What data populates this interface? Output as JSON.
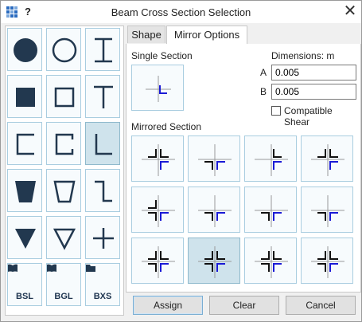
{
  "window": {
    "title": "Beam Cross Section Selection",
    "help_label": "?",
    "close_glyph": "✕",
    "app_icon": "grid-icon",
    "accent_color": "#2a6bbf",
    "selected_tile_color": "#cfe3ec"
  },
  "shapes": [
    {
      "name": "solid-circle",
      "icon": "solid-circle-icon"
    },
    {
      "name": "hollow-circle",
      "icon": "hollow-circle-icon"
    },
    {
      "name": "i-beam",
      "icon": "i-beam-icon"
    },
    {
      "name": "solid-square",
      "icon": "solid-square-icon"
    },
    {
      "name": "hollow-square",
      "icon": "hollow-square-icon"
    },
    {
      "name": "t-section",
      "icon": "t-section-icon"
    },
    {
      "name": "channel",
      "icon": "channel-icon"
    },
    {
      "name": "lipped-channel",
      "icon": "lipped-channel-icon"
    },
    {
      "name": "angle",
      "icon": "angle-icon",
      "selected": true
    },
    {
      "name": "solid-trapezoid",
      "icon": "solid-trapezoid-icon"
    },
    {
      "name": "hollow-trapezoid",
      "icon": "hollow-trapezoid-icon"
    },
    {
      "name": "z-section",
      "icon": "z-section-icon"
    },
    {
      "name": "solid-triangle",
      "icon": "solid-triangle-icon"
    },
    {
      "name": "hollow-triangle",
      "icon": "hollow-triangle-icon"
    },
    {
      "name": "cross",
      "icon": "cross-icon"
    }
  ],
  "libraries": [
    {
      "label": "BSL",
      "icon": "book-icon"
    },
    {
      "label": "BGL",
      "icon": "book-icon"
    },
    {
      "label": "BXS",
      "icon": "folder-icon"
    }
  ],
  "tabs": [
    {
      "label": "Shape",
      "active": false
    },
    {
      "label": "Mirror Options",
      "active": true
    }
  ],
  "mirror": {
    "single_section_label": "Single Section",
    "dimensions_label": "Dimensions: m",
    "dim_a_label": "A",
    "dim_a_value": "0.005",
    "dim_b_label": "B",
    "dim_b_value": "0.005",
    "compatible_shear_label": "Compatible Shear",
    "compatible_shear_checked": false,
    "mirrored_section_label": "Mirrored Section",
    "arrangements": [
      {
        "name": "mirror-ab-1"
      },
      {
        "name": "mirror-b-1"
      },
      {
        "name": "mirror-a-1"
      },
      {
        "name": "mirror-a-2"
      },
      {
        "name": "mirror-ab-2"
      },
      {
        "name": "mirror-ab-3"
      },
      {
        "name": "mirror-ab-4"
      },
      {
        "name": "mirror-ab-5"
      },
      {
        "name": "mirror-ab-6"
      },
      {
        "name": "mirror-quad-1",
        "selected": true
      },
      {
        "name": "mirror-ab-7"
      },
      {
        "name": "mirror-ab-8"
      }
    ]
  },
  "buttons": {
    "assign": "Assign",
    "clear": "Clear",
    "cancel": "Cancel"
  }
}
